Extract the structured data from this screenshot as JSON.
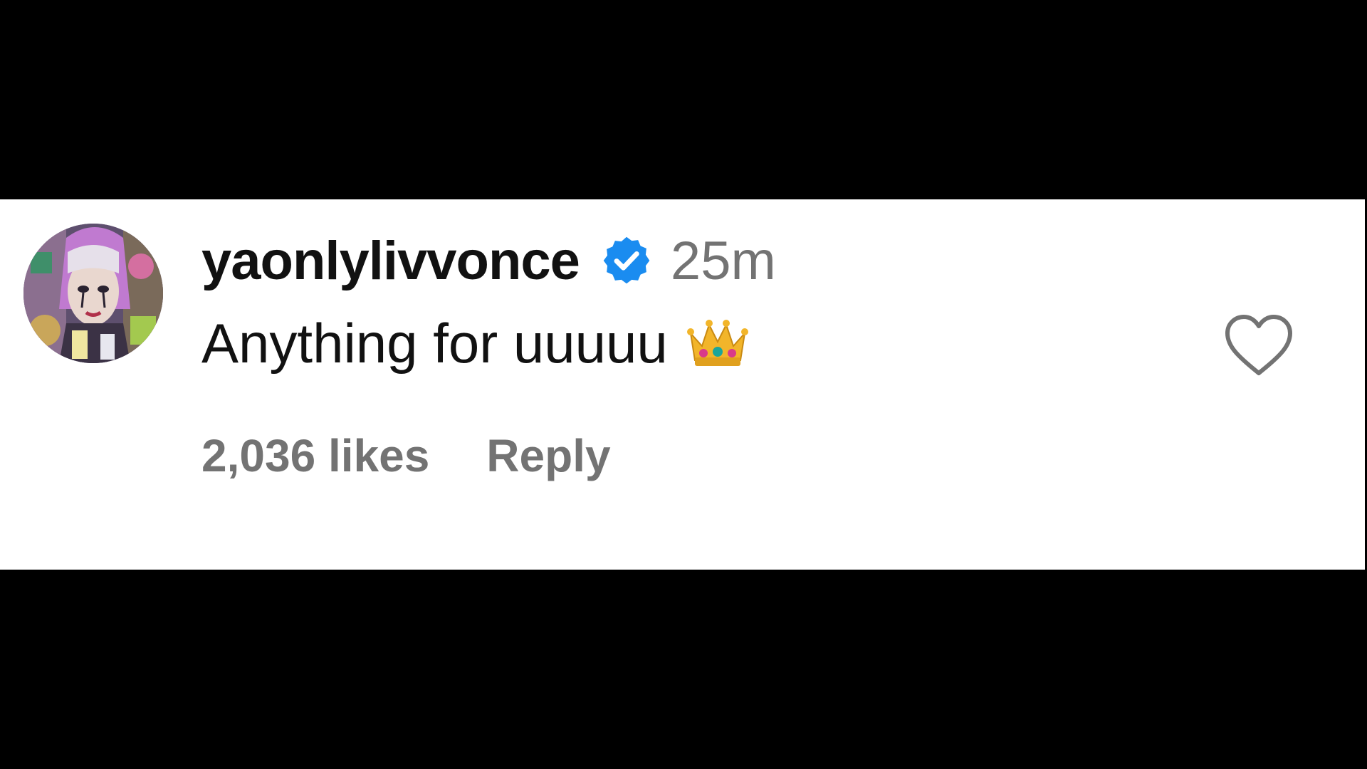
{
  "comment": {
    "username": "yaonlylivvonce",
    "verified": true,
    "timestamp": "25m",
    "text": "Anything for uuuuu",
    "emoji_icon": "crown-emoji-icon",
    "likes_label": "2,036 likes",
    "reply_label": "Reply",
    "like_icon": "heart-outline-icon"
  },
  "colors": {
    "background_bars": "#000000",
    "card_background": "#ffffff",
    "primary_text": "#111111",
    "secondary_text": "#737373",
    "verified_badge": "#1a8cf0"
  }
}
